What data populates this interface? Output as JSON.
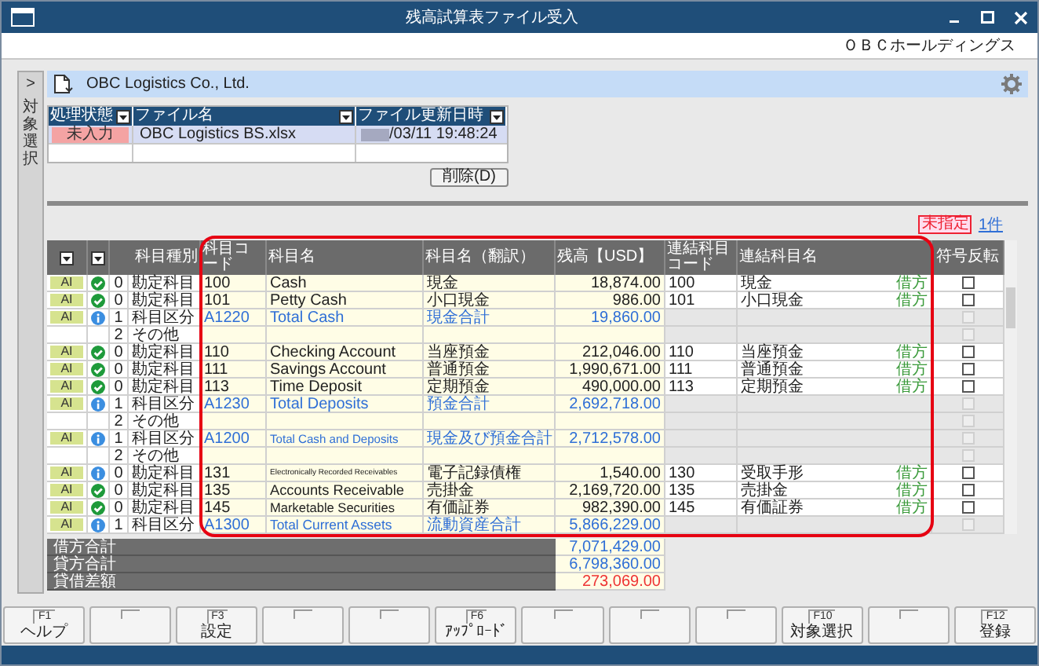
{
  "window": {
    "title": "残高試算表ファイル受入"
  },
  "company_header": "ＯＢＣホールディングス",
  "side_tab": {
    "arrow": ">",
    "label": "対象選択"
  },
  "company_bar": {
    "name": "OBC Logistics Co., Ltd."
  },
  "file_table": {
    "columns": [
      "処理状態",
      "ファイル名",
      "ファイル更新日時"
    ],
    "rows": [
      {
        "status": "未入力",
        "file": "OBC Logistics BS.xlsx",
        "updated": "/03/11 19:48:24",
        "updated_masked": true
      }
    ]
  },
  "delete_button": "削除(D)",
  "filter": {
    "badge": "未指定",
    "count": "1件"
  },
  "main_grid": {
    "columns": [
      {
        "kind": "dropdown",
        "highlighted": false
      },
      {
        "kind": "dropdown",
        "highlighted": false
      },
      {
        "label": "科目種別",
        "kind": "text",
        "span": true,
        "highlighted": false
      },
      {
        "label": "科目コード",
        "kind": "text",
        "highlighted": true
      },
      {
        "label": "科目名",
        "kind": "text",
        "highlighted": true
      },
      {
        "label": "科目名（翻訳）",
        "kind": "text",
        "highlighted": true
      },
      {
        "label": "残高【USD】",
        "kind": "text",
        "highlighted": true
      },
      {
        "label": "連結科目コード",
        "kind": "text",
        "highlighted": true
      },
      {
        "label": "連結科目名",
        "kind": "text",
        "highlighted": true
      },
      {
        "label": "符号反転",
        "kind": "text",
        "highlighted": false
      }
    ],
    "rows": [
      {
        "kind": "account",
        "badge": "AI",
        "icon": {
          "kind": "check"
        },
        "tier": "0",
        "type": "勘定科目",
        "code": "100",
        "name": "Cash",
        "translation": "現金",
        "balance": "18,874.00",
        "linked_code": "100",
        "linked_name": "現金",
        "side": "借方",
        "flip_checked": false
      },
      {
        "kind": "account",
        "badge": "AI",
        "icon": {
          "kind": "check"
        },
        "tier": "0",
        "type": "勘定科目",
        "code": "101",
        "name": "Petty Cash",
        "translation": "小口現金",
        "balance": "986.00",
        "linked_code": "101",
        "linked_name": "小口現金",
        "side": "借方",
        "flip_checked": false
      },
      {
        "kind": "total",
        "badge": "AI",
        "icon": {
          "kind": "info"
        },
        "tier": "1",
        "type": "科目区分",
        "code": "A1220",
        "name": "Total Cash",
        "translation": "現金合計",
        "balance": "19,860.00",
        "flip_checked": false
      },
      {
        "kind": "other",
        "tier": "2",
        "type": "その他",
        "flip_checked": false
      },
      {
        "kind": "account",
        "badge": "AI",
        "icon": {
          "kind": "check"
        },
        "tier": "0",
        "type": "勘定科目",
        "code": "110",
        "name": "Checking Account",
        "translation": "当座預金",
        "balance": "212,046.00",
        "linked_code": "110",
        "linked_name": "当座預金",
        "side": "借方",
        "flip_checked": false
      },
      {
        "kind": "account",
        "badge": "AI",
        "icon": {
          "kind": "check"
        },
        "tier": "0",
        "type": "勘定科目",
        "code": "111",
        "name": "Savings Account",
        "translation": "普通預金",
        "balance": "1,990,671.00",
        "linked_code": "111",
        "linked_name": "普通預金",
        "side": "借方",
        "flip_checked": false
      },
      {
        "kind": "account",
        "badge": "AI",
        "icon": {
          "kind": "check"
        },
        "tier": "0",
        "type": "勘定科目",
        "code": "113",
        "name": "Time Deposit",
        "translation": "定期預金",
        "balance": "490,000.00",
        "linked_code": "113",
        "linked_name": "定期預金",
        "side": "借方",
        "flip_checked": false
      },
      {
        "kind": "total",
        "badge": "AI",
        "icon": {
          "kind": "info"
        },
        "tier": "1",
        "type": "科目区分",
        "code": "A1230",
        "name": "Total Deposits",
        "translation": "預金合計",
        "balance": "2,692,718.00",
        "flip_checked": false
      },
      {
        "kind": "other",
        "tier": "2",
        "type": "その他",
        "flip_checked": false
      },
      {
        "kind": "total",
        "badge": "AI",
        "icon": {
          "kind": "info"
        },
        "tier": "1",
        "type": "科目区分",
        "code": "A1200",
        "name": "Total Cash and Deposits",
        "translation": "現金及び預金合計",
        "balance": "2,712,578.00",
        "flip_checked": false
      },
      {
        "kind": "other",
        "tier": "2",
        "type": "その他",
        "flip_checked": false
      },
      {
        "kind": "account",
        "badge": "AI",
        "icon": {
          "kind": "info"
        },
        "tier": "0",
        "type": "勘定科目",
        "code": "131",
        "name": "Electronically Recorded Receivables",
        "translation": "電子記録債権",
        "balance": "1,540.00",
        "linked_code": "130",
        "linked_name": "受取手形",
        "side": "借方",
        "flip_checked": false
      },
      {
        "kind": "account",
        "badge": "AI",
        "icon": {
          "kind": "check"
        },
        "tier": "0",
        "type": "勘定科目",
        "code": "135",
        "name": "Accounts Receivable",
        "translation": "売掛金",
        "balance": "2,169,720.00",
        "linked_code": "135",
        "linked_name": "売掛金",
        "side": "借方",
        "flip_checked": false
      },
      {
        "kind": "account",
        "badge": "AI",
        "icon": {
          "kind": "check"
        },
        "tier": "0",
        "type": "勘定科目",
        "code": "145",
        "name": "Marketable Securities",
        "translation": "有価証券",
        "balance": "982,390.00",
        "linked_code": "145",
        "linked_name": "有価証券",
        "side": "借方",
        "flip_checked": false
      },
      {
        "kind": "total",
        "badge": "AI",
        "icon": {
          "kind": "info"
        },
        "tier": "1",
        "type": "科目区分",
        "code": "A1300",
        "name": "Total Current Assets",
        "translation": "流動資産合計",
        "balance": "5,866,229.00",
        "flip_checked": false
      }
    ],
    "summary": [
      {
        "label": "借方合計",
        "value": "7,071,429.00",
        "color": "#2f6fd6"
      },
      {
        "label": "貸方合計",
        "value": "6,798,360.00",
        "color": "#2f6fd6"
      },
      {
        "label": "貸借差額",
        "value": "273,069.00",
        "color": "#ee3333"
      }
    ]
  },
  "function_keys": [
    {
      "kind": "function",
      "key": "F1",
      "label": "ヘルプ"
    },
    {
      "kind": "blank"
    },
    {
      "kind": "function",
      "key": "F3",
      "label": "設定"
    },
    {
      "kind": "blank"
    },
    {
      "kind": "blank"
    },
    {
      "kind": "function",
      "key": "F6",
      "label": "ｱｯﾌﾟﾛｰﾄﾞ"
    },
    {
      "kind": "blank"
    },
    {
      "kind": "blank"
    },
    {
      "kind": "blank"
    },
    {
      "kind": "function",
      "key": "F10",
      "label": "対象選択"
    },
    {
      "kind": "blank"
    },
    {
      "kind": "function",
      "key": "F12",
      "label": "登録"
    }
  ]
}
